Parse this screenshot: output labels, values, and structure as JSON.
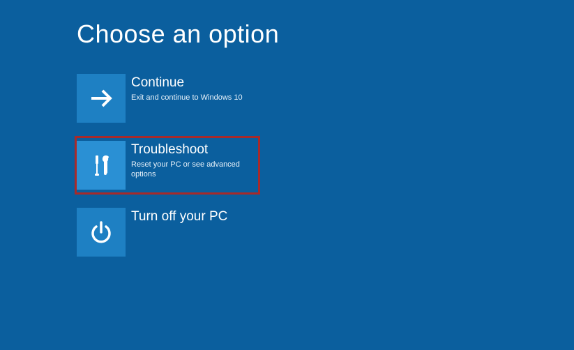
{
  "page": {
    "title": "Choose an option"
  },
  "options": [
    {
      "title": "Continue",
      "desc": "Exit and continue to Windows 10",
      "icon": "arrow-right-icon",
      "highlighted": false
    },
    {
      "title": "Troubleshoot",
      "desc": "Reset your PC or see advanced options",
      "icon": "tools-icon",
      "highlighted": true
    },
    {
      "title": "Turn off your PC",
      "desc": "",
      "icon": "power-icon",
      "highlighted": false
    }
  ],
  "colors": {
    "background": "#0b5f9e",
    "tile": "#1e80c3",
    "tile_highlight": "#2a90d4",
    "highlight_border": "#a82a2a"
  }
}
